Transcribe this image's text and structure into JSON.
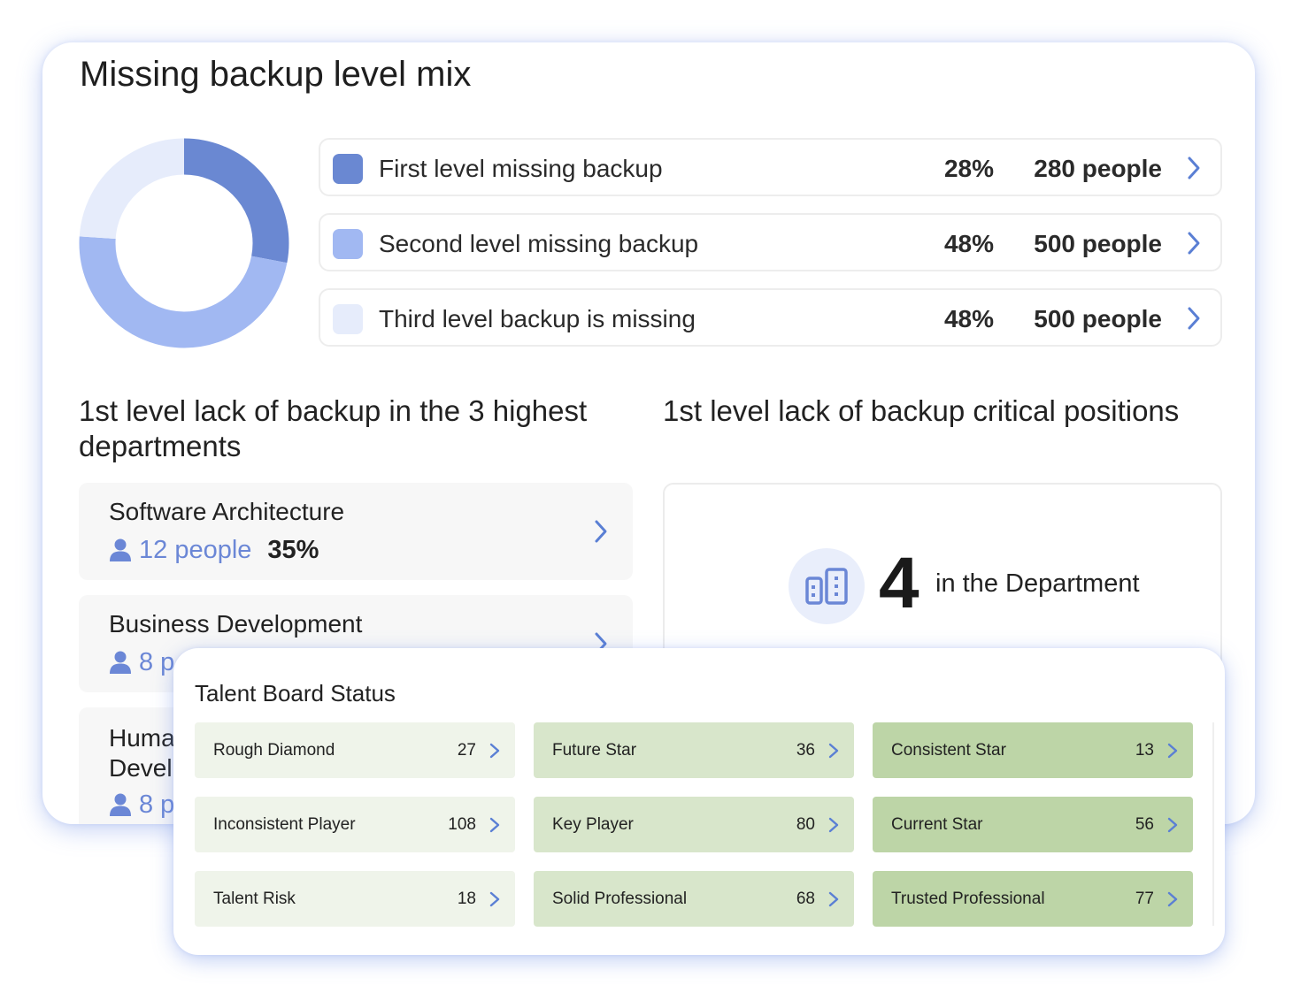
{
  "main": {
    "title": "Missing backup level mix",
    "mix": [
      {
        "label": "First level missing backup",
        "percent": "28%",
        "people": "280 people",
        "color": "#6a88d2",
        "share": 0.28
      },
      {
        "label": "Second level missing backup",
        "percent": "48%",
        "people": "500 people",
        "color": "#a1b8f2",
        "share": 0.48
      },
      {
        "label": "Third level backup is missing",
        "percent": "48%",
        "people": "500 people",
        "color": "#e6ecfb",
        "share": 0.24
      }
    ]
  },
  "departments": {
    "title": "1st level lack of backup in the 3 highest departments",
    "items": [
      {
        "name": "Software Architecture",
        "count": "12 people",
        "percent": "35%"
      },
      {
        "name": "Business Development",
        "count": "8 p",
        "percent": ""
      },
      {
        "name": "Huma\nDevel",
        "count": "8 p",
        "percent": ""
      }
    ]
  },
  "critical": {
    "title": "1st level lack of backup critical positions",
    "value": "4",
    "text": "in the Department",
    "icon": "building-icon"
  },
  "talent": {
    "title": "Talent Board Status",
    "tiles": [
      {
        "label": "Rough Diamond",
        "value": "27",
        "color": "#eff4ea"
      },
      {
        "label": "Future Star",
        "value": "36",
        "color": "#d8e6cb"
      },
      {
        "label": "Consistent Star",
        "value": "13",
        "color": "#bdd5a7"
      },
      {
        "label": "Inconsistent Player",
        "value": "108",
        "color": "#eff4ea"
      },
      {
        "label": "Key Player",
        "value": "80",
        "color": "#d8e6cb"
      },
      {
        "label": "Current Star",
        "value": "56",
        "color": "#bdd5a7"
      },
      {
        "label": "Talent Risk",
        "value": "18",
        "color": "#eff4ea"
      },
      {
        "label": "Solid Professional",
        "value": "68",
        "color": "#d8e6cb"
      },
      {
        "label": "Trusted Professional",
        "value": "77",
        "color": "#bdd5a7"
      }
    ]
  },
  "colors": {
    "accent": "#6b87d6",
    "chevron": "#5a7fd4"
  }
}
